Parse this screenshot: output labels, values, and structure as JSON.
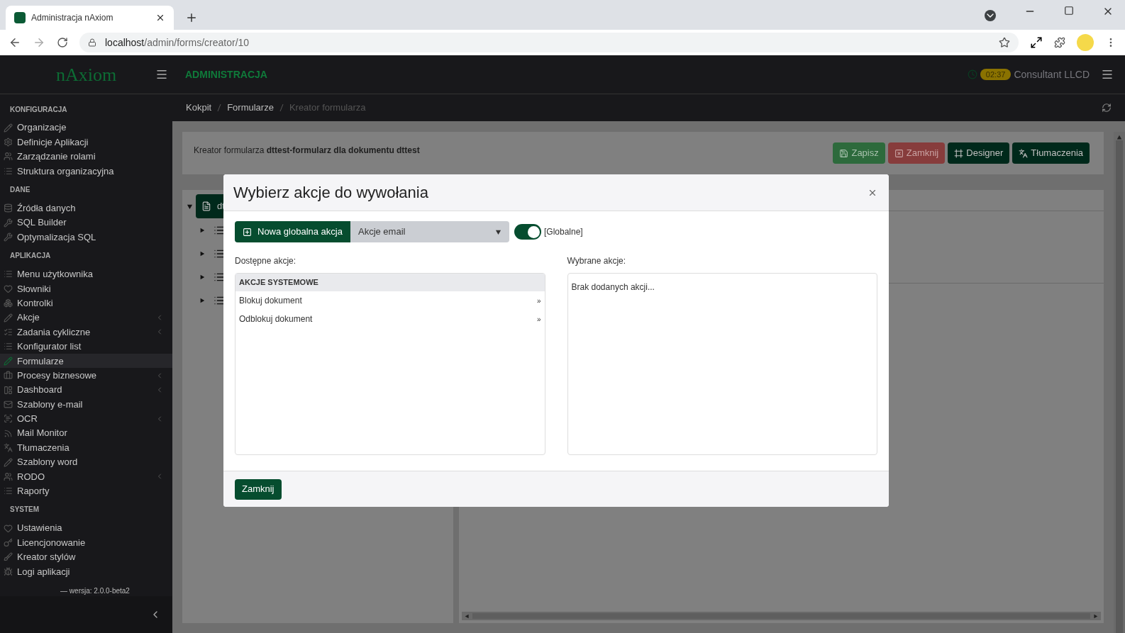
{
  "browser": {
    "tab_title": "Administracja nAxiom",
    "url_host": "localhost",
    "url_path": "/admin/forms/creator/10"
  },
  "header": {
    "logo": "nAxiom",
    "title": "ADMINISTRACJA",
    "badge": "02:37",
    "user": "Consultant LLCD"
  },
  "breadcrumbs": [
    {
      "label": "Kokpit",
      "current": false
    },
    {
      "label": "Formularze",
      "current": false
    },
    {
      "label": "Kreator formularza",
      "current": true
    }
  ],
  "sidebar": {
    "sections": [
      {
        "title": "KONFIGURACJA",
        "items": [
          {
            "label": "Organizacje",
            "selected": false,
            "expandable": false
          },
          {
            "label": "Definicje Aplikacji",
            "selected": false,
            "expandable": false
          },
          {
            "label": "Zarządzanie rolami",
            "selected": false,
            "expandable": false
          },
          {
            "label": "Struktura organizacyjna",
            "selected": false,
            "expandable": false
          }
        ]
      },
      {
        "title": "DANE",
        "items": [
          {
            "label": "Źródła danych",
            "selected": false,
            "expandable": false
          },
          {
            "label": "SQL Builder",
            "selected": false,
            "expandable": false
          },
          {
            "label": "Optymalizacja SQL",
            "selected": false,
            "expandable": false
          }
        ]
      },
      {
        "title": "APLIKACJA",
        "items": [
          {
            "label": "Menu użytkownika",
            "selected": false,
            "expandable": false
          },
          {
            "label": "Słowniki",
            "selected": false,
            "expandable": false
          },
          {
            "label": "Kontrolki",
            "selected": false,
            "expandable": false
          },
          {
            "label": "Akcje",
            "selected": false,
            "expandable": true
          },
          {
            "label": "Zadania cykliczne",
            "selected": false,
            "expandable": true
          },
          {
            "label": "Konfigurator list",
            "selected": false,
            "expandable": false
          },
          {
            "label": "Formularze",
            "selected": true,
            "expandable": false
          },
          {
            "label": "Procesy biznesowe",
            "selected": false,
            "expandable": true
          },
          {
            "label": "Dashboard",
            "selected": false,
            "expandable": true
          },
          {
            "label": "Szablony e-mail",
            "selected": false,
            "expandable": false
          },
          {
            "label": "OCR",
            "selected": false,
            "expandable": true
          },
          {
            "label": "Mail Monitor",
            "selected": false,
            "expandable": false
          },
          {
            "label": "Tłumaczenia",
            "selected": false,
            "expandable": false
          },
          {
            "label": "Szablony word",
            "selected": false,
            "expandable": false
          },
          {
            "label": "RODO",
            "selected": false,
            "expandable": true
          },
          {
            "label": "Raporty",
            "selected": false,
            "expandable": false
          }
        ]
      },
      {
        "title": "SYSTEM",
        "items": [
          {
            "label": "Ustawienia",
            "selected": false,
            "expandable": false
          },
          {
            "label": "Licencjonowanie",
            "selected": false,
            "expandable": false
          },
          {
            "label": "Kreator stylów",
            "selected": false,
            "expandable": false
          },
          {
            "label": "Logi aplikacji",
            "selected": false,
            "expandable": false
          }
        ]
      }
    ],
    "version": "— wersja: 2.0.0-beta2"
  },
  "page": {
    "title": "Kreator formularza **dttest-formularz dla dokumentu dttest**",
    "buttons": [
      {
        "label": "Zapisz",
        "kind": "save"
      },
      {
        "label": "Zamknij",
        "kind": "close"
      },
      {
        "label": "Designer",
        "kind": "designer"
      },
      {
        "label": "Tłumaczenia",
        "kind": "translations"
      }
    ]
  },
  "tree": {
    "root": {
      "label": "dt",
      "expanded": true
    },
    "children": [
      {
        "expanded": false
      },
      {
        "expanded": false
      },
      {
        "expanded": false
      },
      {
        "expanded": false
      }
    ]
  },
  "modal": {
    "title": "Wybierz akcje do wywołania",
    "new_button": "Nowa globalna akcja",
    "select_value": "Akcje email",
    "toggle": {
      "on": true,
      "label": "[Globalne]"
    },
    "available_label": "Dostępne akcje:",
    "groups": [
      {
        "title": "AKCJE SYSTEMOWE",
        "items": [
          {
            "label": "Blokuj dokument",
            "marker": "»"
          },
          {
            "label": "Odblokuj dokument",
            "marker": "»"
          }
        ]
      }
    ],
    "selected_label": "Wybrane akcje:",
    "selected_empty": "Brak dodanych akcji...",
    "footer_button": "Zamknij"
  }
}
